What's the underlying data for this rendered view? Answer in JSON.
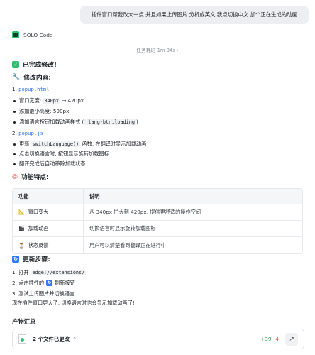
{
  "user_message": "插件窗口帮我改大一点  并且如果上传图片 分析成英文 我点切换中文 加个正在生成的动画",
  "agent": {
    "name": "SOLO Code",
    "elapsed": "任务耗时 1m 34s ›"
  },
  "done_heading": "已完成修改!",
  "changes_heading": "修改内容:",
  "files": [
    {
      "index": "1.",
      "name": "popup.html",
      "bullets": [
        [
          "窗口宽度: ",
          "340px",
          " → 420px"
        ],
        [
          "添加最小高度: 500px"
        ],
        [
          "添加语言按钮加载动画样式 (",
          ".lang-btn.loading",
          ")"
        ]
      ]
    },
    {
      "index": "2.",
      "name": "popup.js",
      "bullets": [
        [
          "更新 ",
          "switchLanguage()",
          " 函数, 在翻译时显示加载动画"
        ],
        [
          "点击切换语言时, 按钮显示旋转加载图标"
        ],
        [
          "翻译完成后自动移除加载状态"
        ]
      ]
    }
  ],
  "features_heading": "功能特点:",
  "table": {
    "headers": [
      "功能",
      "说明"
    ],
    "rows": [
      {
        "icon": "📐",
        "feature": "窗口变大",
        "desc": "从 340px 扩大到 420px, 提供更舒适的操作空间"
      },
      {
        "icon": "🎬",
        "feature": "加载动画",
        "desc": "切换语言时显示旋转加载图标"
      },
      {
        "icon": "⏳",
        "feature": "状态反馈",
        "desc": "用户可以清楚看到翻译正在进行中"
      }
    ]
  },
  "update_heading": "更新步骤:",
  "steps": [
    {
      "pre": "1. 打开 ",
      "code": "edge://extensions/",
      "post": ""
    },
    {
      "pre": "2. 点击插件的 ",
      "icon": "↻",
      "post": " 刷新按钮"
    },
    {
      "pre": "3. 测试上传图片并切换语言",
      "post": ""
    }
  ],
  "summary": "现在插件窗口更大了, 切换语言时也会显示加载动画了!",
  "products_title": "产物汇总",
  "changes_card": {
    "label": "2 个文件已更改",
    "additions": "+39",
    "deletions": "-4"
  },
  "colors": {
    "accent": "#3478f6",
    "green": "#2fbf71",
    "red": "#e2554a"
  }
}
